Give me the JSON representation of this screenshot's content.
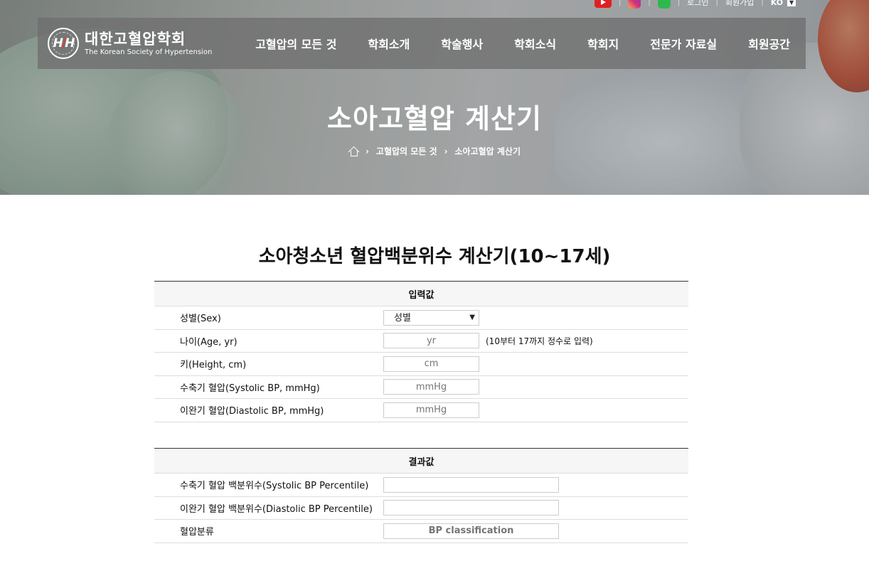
{
  "utility": {
    "login": "로그인",
    "signup": "회원가입",
    "lang": "KO",
    "icons": [
      "youtube-icon",
      "instagram-icon",
      "line-icon"
    ]
  },
  "logo": {
    "name_ko": "대한고혈압학회",
    "name_en": "The Korean Society of Hypertension"
  },
  "nav": {
    "items": [
      "고혈압의 모든 것",
      "학회소개",
      "학술행사",
      "학회소식",
      "학회지",
      "전문가 자료실",
      "회원공간"
    ]
  },
  "hero": {
    "title": "소아고혈압 계산기",
    "breadcrumb": [
      "고혈압의 모든 것",
      "소아고혈압 계산기"
    ]
  },
  "main": {
    "heading": "소아청소년 혈압백분위수 계산기(10~17세)",
    "input_section": {
      "title": "입력값",
      "sex_label": "성별(Sex)",
      "sex_selected": "성별",
      "age_label": "나이(Age, yr)",
      "age_placeholder": "yr",
      "age_hint": "(10부터 17까지 정수로 입력)",
      "height_label": "키(Height, cm)",
      "height_placeholder": "cm",
      "sbp_label": "수축기 혈압(Systolic BP, mmHg)",
      "sbp_placeholder": "mmHg",
      "dbp_label": "이완기 혈압(Diastolic BP, mmHg)",
      "dbp_placeholder": "mmHg"
    },
    "result_section": {
      "title": "결과값",
      "sbp_pct_label": "수축기 혈압 백분위수(Systolic BP Percentile)",
      "dbp_pct_label": "이완기 혈압 백분위수(Diastolic BP Percentile)",
      "class_label": "혈압분류",
      "class_placeholder": "BP classification"
    }
  },
  "colors": {
    "youtube": "#e02020",
    "line": "#2fb84d",
    "navbar": "#6e6e6e"
  }
}
